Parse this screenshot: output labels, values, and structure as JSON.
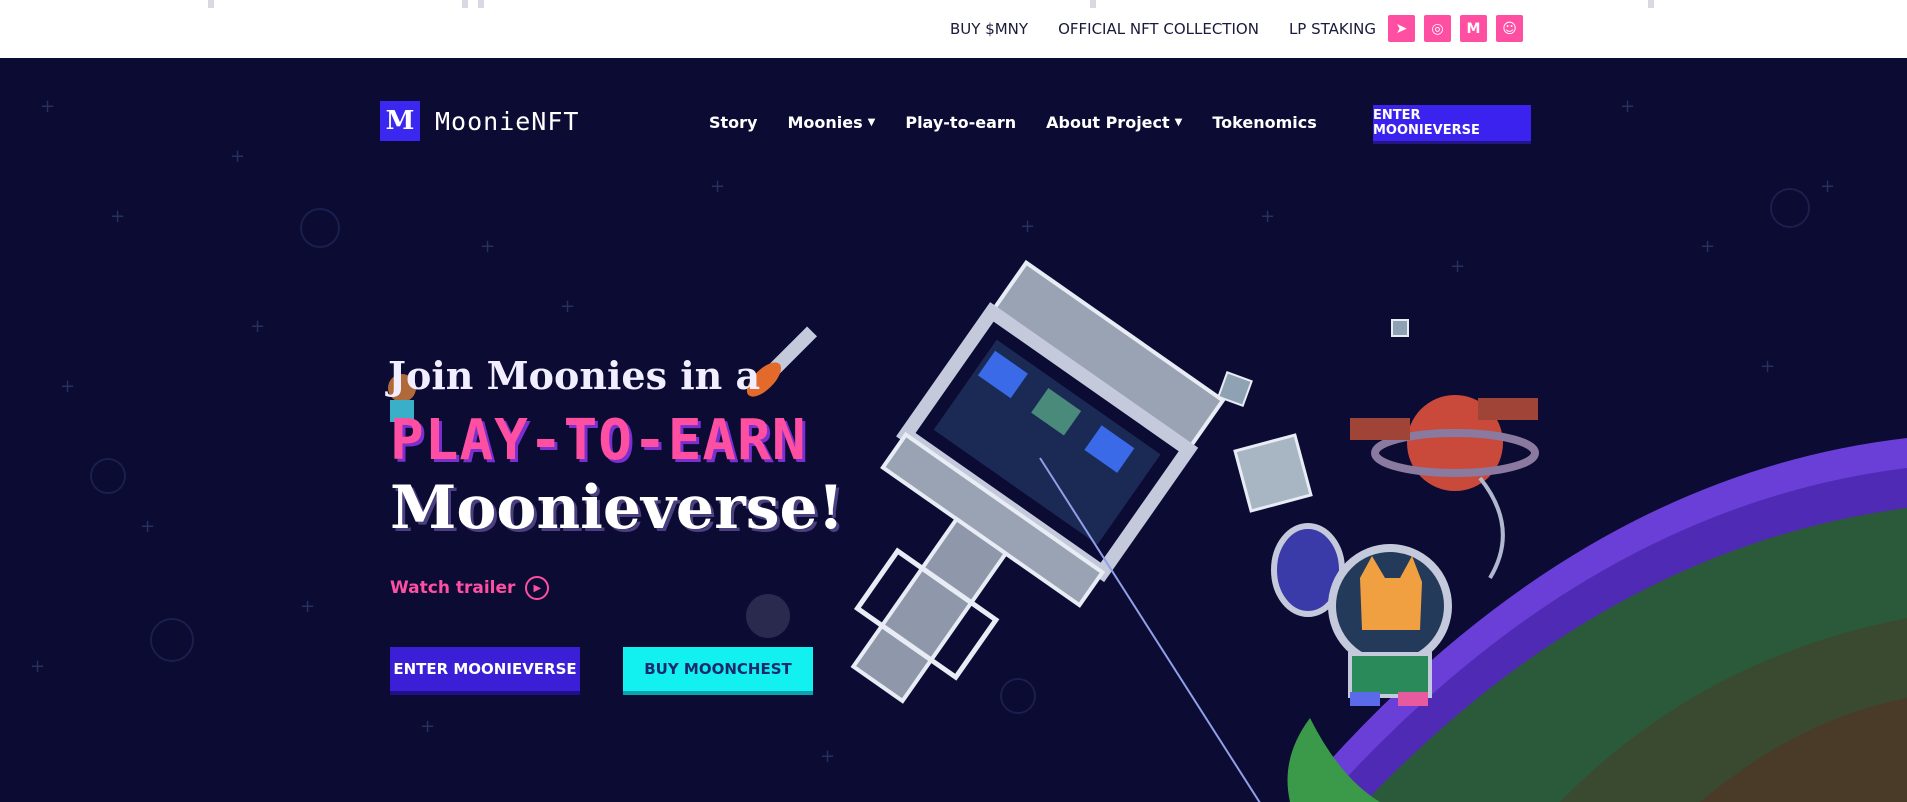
{
  "topbar": {
    "links": [
      "BUY $MNY",
      "OFFICIAL NFT COLLECTION",
      "LP STAKING"
    ],
    "socials": [
      {
        "icon": "telegram-icon",
        "glyph": "➤"
      },
      {
        "icon": "instagram-icon",
        "glyph": "◎"
      },
      {
        "icon": "medium-icon",
        "glyph": "M"
      },
      {
        "icon": "discord-icon",
        "glyph": "☺"
      }
    ]
  },
  "logo": {
    "mark": "M",
    "text": "MoonieNFT"
  },
  "nav": {
    "items": [
      {
        "label": "Story"
      },
      {
        "label": "Moonies"
      },
      {
        "label": "Play-to-earn"
      },
      {
        "label": "About Project"
      },
      {
        "label": "Tokenomics"
      }
    ],
    "cta": "ENTER MOONIEVERSE"
  },
  "hero": {
    "line1": "Join Moonies in a",
    "line2": "PLAY-TO-EARN",
    "line3": "Moonieverse!",
    "trailer": "Watch trailer",
    "primary_button": "ENTER MOONIEVERSE",
    "secondary_button": "BUY MOONCHEST"
  },
  "colors": {
    "accent_pink": "#ff4fa3",
    "accent_blue": "#3b22ee",
    "accent_cyan": "#12f0f0",
    "background": "#0b0b33"
  }
}
